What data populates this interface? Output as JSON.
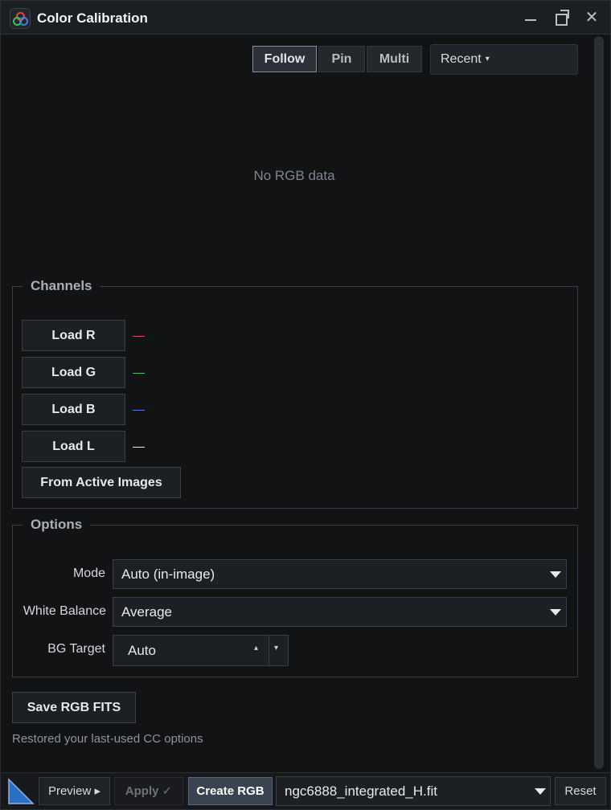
{
  "window": {
    "title": "Color Calibration",
    "minimize_icon": "minimize-icon",
    "maximize_icon": "maximize-icon",
    "close_glyph": "✕"
  },
  "toolbar": {
    "tabs": [
      {
        "label": "Follow",
        "active": true
      },
      {
        "label": "Pin",
        "active": false
      },
      {
        "label": "Multi",
        "active": false
      }
    ],
    "recent_label": "Recent",
    "recent_caret": "▾"
  },
  "preview": {
    "empty_message": "No RGB data"
  },
  "channels": {
    "title": "Channels",
    "load_r": "Load R",
    "load_g": "Load G",
    "load_b": "Load B",
    "load_l": "Load L",
    "from_active": "From Active Images",
    "colors": {
      "r": "#e24c4c",
      "g": "#41c760",
      "b": "#4c7fe0",
      "l": "#e8e8e8"
    }
  },
  "options": {
    "title": "Options",
    "mode_label": "Mode",
    "mode_value": "Auto (in-image)",
    "wb_label": "White Balance",
    "wb_value": "Average",
    "bg_label": "BG Target",
    "bg_value": "Auto",
    "spin_up": "▴",
    "spin_down": "▾"
  },
  "actions": {
    "save_label": "Save RGB FITS",
    "status": "Restored your last-used CC options"
  },
  "bottombar": {
    "preview_label": "Preview ▸",
    "apply_label": "Apply ✓",
    "create_label": "Create RGB",
    "file_value": "ngc6888_integrated_H.fit",
    "reset_label": "Reset"
  }
}
